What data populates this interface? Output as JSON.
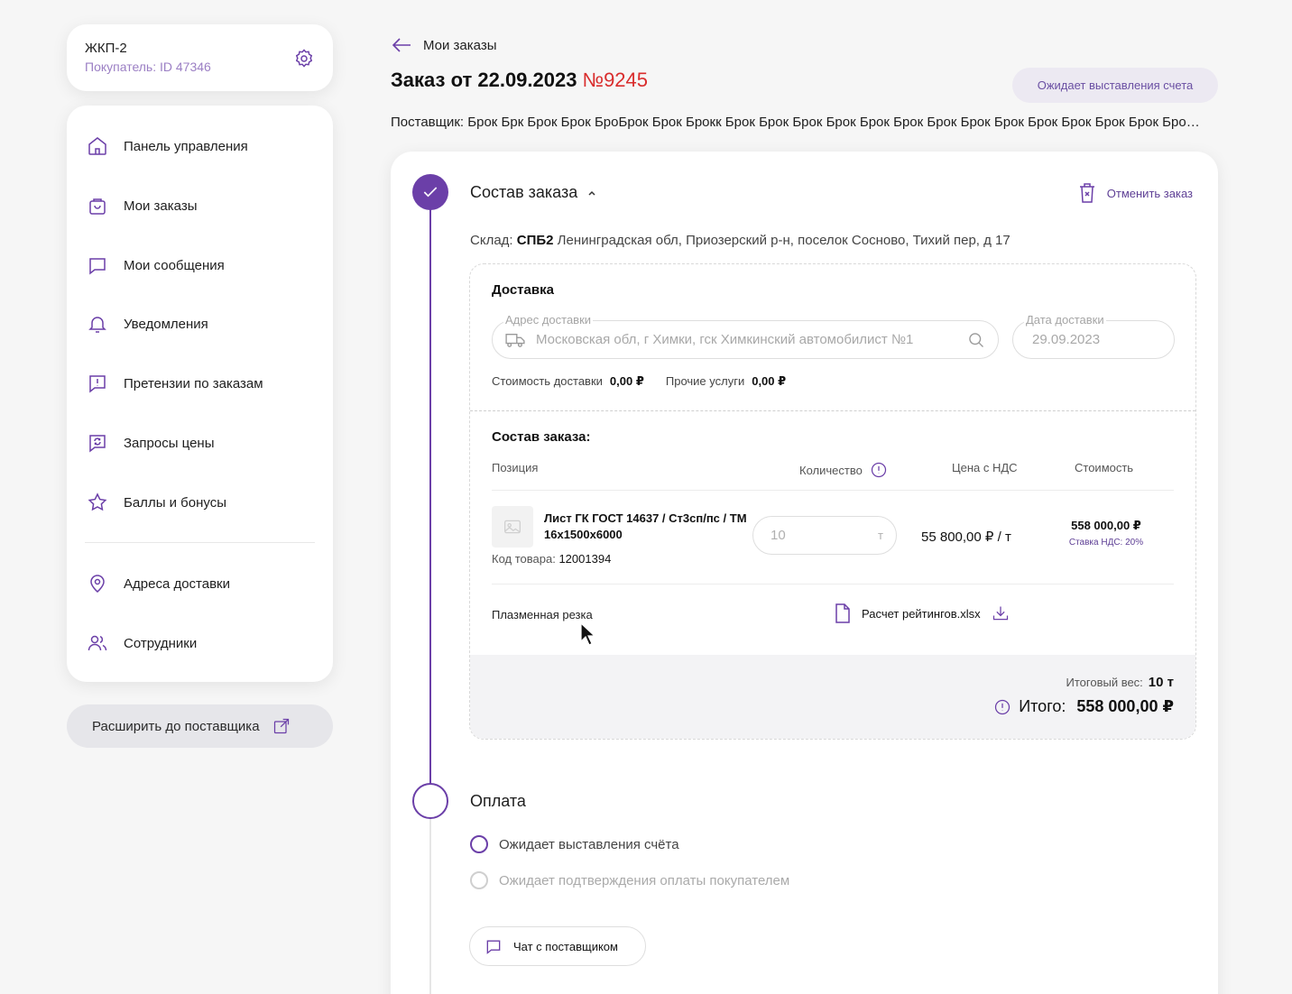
{
  "account": {
    "name": "ЖКП-2",
    "subtitle": "Покупатель: ID 47346"
  },
  "nav": {
    "items": [
      {
        "label": "Панель управления",
        "icon": "home-icon"
      },
      {
        "label": "Мои заказы",
        "icon": "cart-icon"
      },
      {
        "label": "Мои сообщения",
        "icon": "message-icon"
      },
      {
        "label": "Уведомления",
        "icon": "bell-icon"
      },
      {
        "label": "Претензии по заказам",
        "icon": "claim-icon"
      },
      {
        "label": "Запросы цены",
        "icon": "price-request-icon"
      },
      {
        "label": "Баллы и бонусы",
        "icon": "star-icon"
      },
      {
        "label": "Адреса доставки",
        "icon": "location-icon"
      },
      {
        "label": "Сотрудники",
        "icon": "users-icon"
      }
    ],
    "expand_label": "Расширить до поставщика"
  },
  "header": {
    "back_label": "Мои заказы",
    "title": "Заказ от 22.09.2023",
    "order_number": "№9245",
    "status": "Ожидает выставления счета",
    "supplier": "Поставщик: Брок Брк Брок Брок БроБрок Брок Брокк Брок Брок Брок Брок Брок Брок Брок Брок Брок Брок Брок Брок Брок Брок Брок Брок Брок Брок Брок"
  },
  "order": {
    "section_title": "Состав заказа",
    "cancel_label": "Отменить заказ",
    "warehouse_prefix": "Склад:",
    "warehouse_code": "СПБ2",
    "warehouse_address": "Ленинградская обл, Приозерский р-н, поселок Сосново, Тихий пер, д 17",
    "delivery": {
      "heading": "Доставка",
      "address_label": "Адрес доставки",
      "address_value": "Московская обл, г Химки, гск Химкинский автомобилист №1",
      "date_label": "Дата доставки",
      "date_value": "29.09.2023",
      "cost_label": "Стоимость доставки",
      "cost_value": "0,00 ₽",
      "other_label": "Прочие услуги",
      "other_value": "0,00 ₽"
    },
    "composition": {
      "heading": "Состав заказа:",
      "columns": [
        "Позиция",
        "Количество",
        "Цена с НДС",
        "Стоимость"
      ],
      "item": {
        "name": "Лист ГК ГОСТ 14637 / Ст3сп/пс / ТМ 16x1500x6000",
        "code_label": "Код товара:",
        "code": "12001394",
        "qty": "10",
        "unit": "т",
        "price": "55 800,00 ₽ / т",
        "total": "558 000,00 ₽",
        "vat": "Ставка НДС: 20%"
      },
      "service": "Плазменная резка",
      "file": "Расчет рейтингов.xlsx"
    },
    "summary": {
      "weight_label": "Итоговый вес:",
      "weight_value": "10 т",
      "total_label": "Итого:",
      "total_value": "558 000,00 ₽"
    }
  },
  "payment": {
    "title": "Оплата",
    "steps": [
      "Ожидает выставления счёта",
      "Ожидает подтверждения оплаты покупателем"
    ],
    "chat_label": "Чат с поставщиком"
  },
  "colors": {
    "accent": "#6b3fa8",
    "order_number": "#d92d2d",
    "status_bg": "#ece9f2"
  }
}
